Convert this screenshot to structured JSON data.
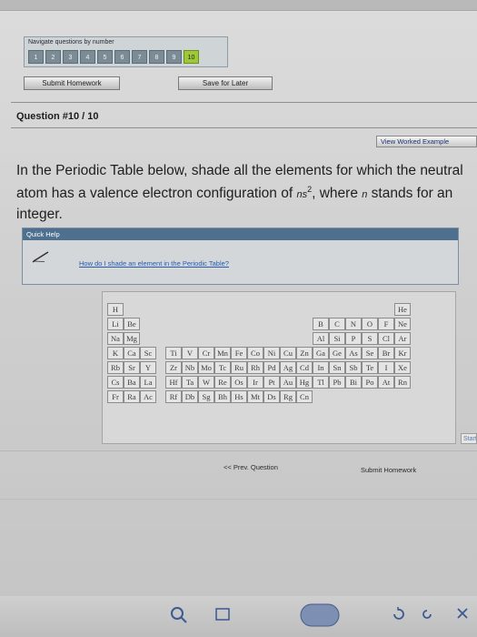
{
  "nav": {
    "label": "Navigate questions by number",
    "numbers": [
      "1",
      "2",
      "3",
      "4",
      "5",
      "6",
      "7",
      "8",
      "9",
      "10"
    ],
    "current": "10"
  },
  "buttons": {
    "submit_homework": "Submit Homework",
    "save_for_later": "Save for Later",
    "view_worked_example": "View Worked Example",
    "prev_question": "<< Prev. Question",
    "submit_homework_bottom": "Submit Homework",
    "start": "Start"
  },
  "question": {
    "title": "Question #10 / 10",
    "text_1": "In the Periodic Table below, shade all the elements for which the neutral atom has a valence electron configuration of ",
    "config_symbol": "ns",
    "config_sup": "2",
    "text_2": ", where ",
    "var_symbol": "n",
    "text_3": " stands for an integer."
  },
  "help": {
    "title": "Quick Help",
    "link": "How do I shade an element in the Periodic Table?"
  },
  "elements": {
    "r1": [
      "H",
      "He"
    ],
    "r2": [
      "Li",
      "Be",
      "B",
      "C",
      "N",
      "O",
      "F",
      "Ne"
    ],
    "r3": [
      "Na",
      "Mg",
      "Al",
      "Si",
      "P",
      "S",
      "Cl",
      "Ar"
    ],
    "r4": [
      "K",
      "Ca",
      "Sc",
      "Ti",
      "V",
      "Cr",
      "Mn",
      "Fe",
      "Co",
      "Ni",
      "Cu",
      "Zn",
      "Ga",
      "Ge",
      "As",
      "Se",
      "Br",
      "Kr"
    ],
    "r5": [
      "Rb",
      "Sr",
      "Y",
      "Zr",
      "Nb",
      "Mo",
      "Tc",
      "Ru",
      "Rh",
      "Pd",
      "Ag",
      "Cd",
      "In",
      "Sn",
      "Sb",
      "Te",
      "I",
      "Xe"
    ],
    "r6": [
      "Cs",
      "Ba",
      "La",
      "Hf",
      "Ta",
      "W",
      "Re",
      "Os",
      "Ir",
      "Pt",
      "Au",
      "Hg",
      "Tl",
      "Pb",
      "Bi",
      "Po",
      "At",
      "Rn"
    ],
    "r7": [
      "Fr",
      "Ra",
      "Ac",
      "Rf",
      "Db",
      "Sg",
      "Bh",
      "Hs",
      "Mt",
      "Ds",
      "Rg",
      "Cn"
    ]
  },
  "colors": {
    "current_nav": "#9fc73a",
    "help_header": "#4f6f8f",
    "link": "#2a5bb0"
  }
}
